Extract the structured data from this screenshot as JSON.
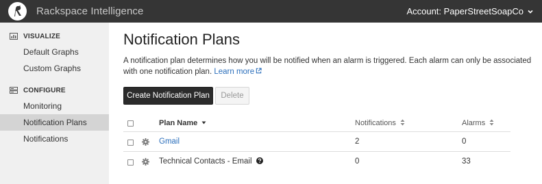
{
  "header": {
    "app_title": "Rackspace Intelligence",
    "account_label": "Account: PaperStreetSoapCo"
  },
  "sidebar": {
    "sections": [
      {
        "title": "VISUALIZE",
        "icon": "chart-icon",
        "items": [
          "Default Graphs",
          "Custom Graphs"
        ]
      },
      {
        "title": "CONFIGURE",
        "icon": "server-icon",
        "items": [
          "Monitoring",
          "Notification Plans",
          "Notifications"
        ]
      }
    ],
    "active_item": "Notification Plans"
  },
  "main": {
    "title": "Notification Plans",
    "description": "A notification plan determines how you will be notified when an alarm is triggered. Each alarm can only be associated with one notification plan.",
    "learn_more": "Learn more",
    "create_button": "Create Notification Plan",
    "delete_button": "Delete"
  },
  "table": {
    "columns": [
      "Plan Name",
      "Notifications",
      "Alarms"
    ],
    "rows": [
      {
        "name": "Gmail",
        "notifications": "2",
        "alarms": "0",
        "is_link": true
      },
      {
        "name": "Technical Contacts - Email",
        "notifications": "0",
        "alarms": "33",
        "is_link": false,
        "has_help": true
      }
    ]
  },
  "colors": {
    "topbar": "#353535",
    "sidebar": "#f0f0f0",
    "active_nav": "#d4d4d4",
    "link": "#2a6ebb",
    "primary_button": "#2b2b2b"
  }
}
